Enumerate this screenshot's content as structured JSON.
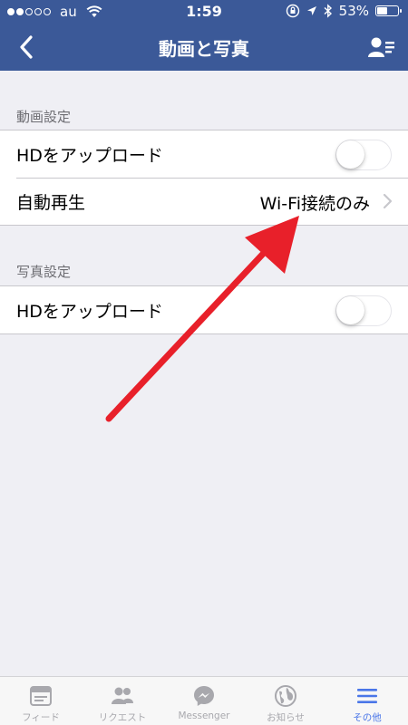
{
  "status_bar": {
    "carrier": "au",
    "time": "1:59",
    "battery": "53%",
    "battery_level": 0.53
  },
  "nav": {
    "title": "動画と写真"
  },
  "video_section": {
    "header": "動画設定",
    "rows": [
      {
        "label": "HDをアップロード",
        "toggle_on": false
      },
      {
        "label": "自動再生",
        "value": "Wi-Fi接続のみ"
      }
    ]
  },
  "photo_section": {
    "header": "写真設定",
    "rows": [
      {
        "label": "HDをアップロード",
        "toggle_on": false
      }
    ]
  },
  "tabs": [
    {
      "label": "フィード",
      "icon": "feed-icon",
      "active": false
    },
    {
      "label": "リクエスト",
      "icon": "friends-icon",
      "active": false
    },
    {
      "label": "Messenger",
      "icon": "messenger-icon",
      "active": false
    },
    {
      "label": "お知らせ",
      "icon": "globe-icon",
      "active": false
    },
    {
      "label": "その他",
      "icon": "menu-icon",
      "active": true
    }
  ],
  "colors": {
    "brand_blue": "#3b5998",
    "active_tab": "#4a76e8",
    "annotation_red": "#e8202a"
  }
}
